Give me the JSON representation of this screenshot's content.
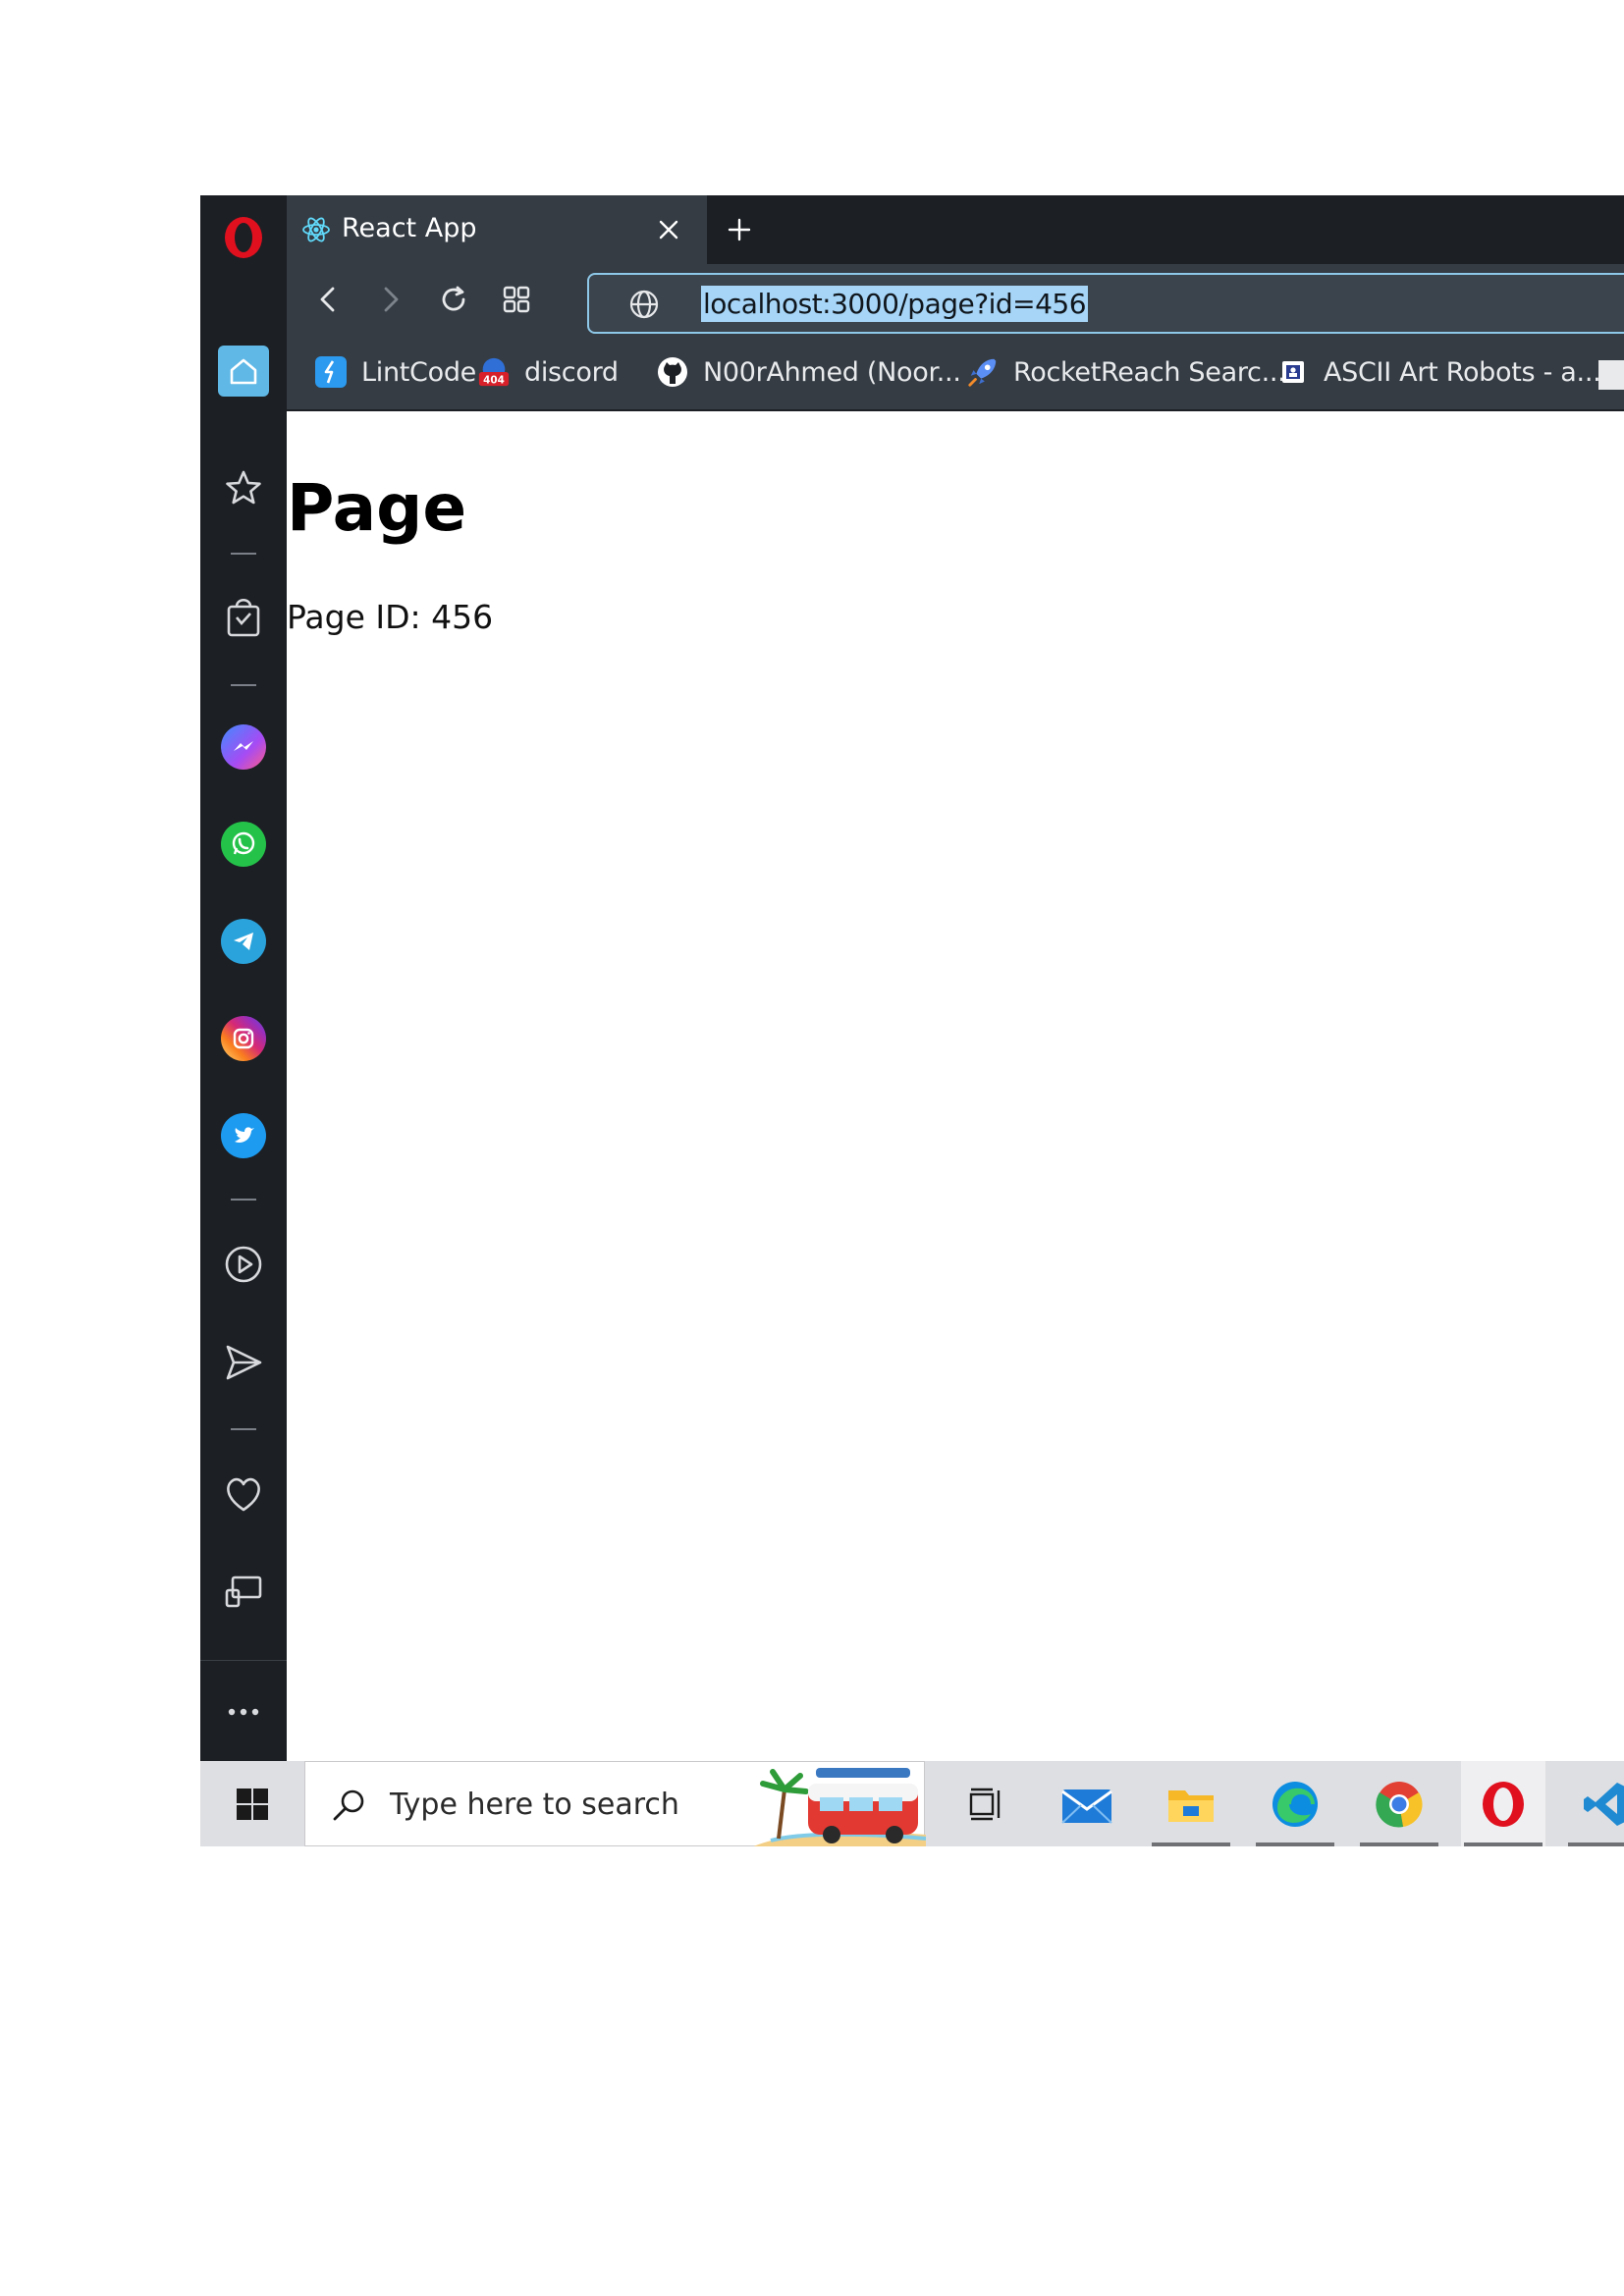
{
  "browser": {
    "tab": {
      "title": "React App",
      "favicon": "react-icon"
    },
    "address": {
      "url": "localhost:3000/page?id=456"
    },
    "bookmarks": [
      {
        "label": "LintCode",
        "icon": "lintcode-icon"
      },
      {
        "label": "discord",
        "icon": "404-icon"
      },
      {
        "label": "N00rAhmed (Noor...",
        "icon": "github-icon"
      },
      {
        "label": "RocketReach Searc...",
        "icon": "rocket-icon"
      },
      {
        "label": "ASCII Art Robots - a...",
        "icon": "ascii-icon"
      }
    ]
  },
  "sidebar": {
    "items": [
      "opera-logo",
      "home-icon",
      "star-icon",
      "shopping-bag-icon",
      "messenger-icon",
      "whatsapp-icon",
      "telegram-icon",
      "instagram-icon",
      "twitter-icon",
      "player-icon",
      "send-icon",
      "heart-icon",
      "history-icon",
      "more-icon"
    ]
  },
  "page": {
    "heading": "Page",
    "id_line": "Page ID: 456"
  },
  "taskbar": {
    "search_placeholder": "Type here to search",
    "apps": [
      "task-view-icon",
      "mail-icon",
      "file-explorer-icon",
      "edge-icon",
      "chrome-icon",
      "opera-icon",
      "vscode-icon"
    ]
  },
  "colors": {
    "sidebar_bg": "#1c1f24",
    "chrome_bg": "#353c44",
    "url_highlight": "#a6d5f7",
    "accent": "#5fb8e6",
    "opera_red": "#e0101f"
  }
}
